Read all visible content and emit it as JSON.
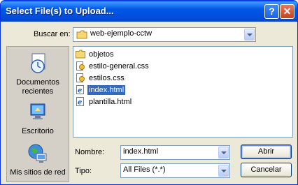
{
  "dialog": {
    "title": "Select File(s) to Upload...",
    "help_symbol": "?",
    "close_symbol": "✕"
  },
  "lookin": {
    "label": "Buscar en:",
    "value": "web-ejemplo-cctw"
  },
  "places": [
    {
      "label": "Documentos recientes",
      "icon": "recent-documents-icon"
    },
    {
      "label": "Escritorio",
      "icon": "desktop-icon"
    },
    {
      "label": "Mis sitios de red",
      "icon": "network-places-icon"
    }
  ],
  "files": [
    {
      "name": "objetos",
      "type": "folder-icon",
      "selected": false
    },
    {
      "name": "estilo-general.css",
      "type": "css-file-icon",
      "selected": false
    },
    {
      "name": "estilos.css",
      "type": "css-file-icon",
      "selected": false
    },
    {
      "name": "index.html",
      "type": "html-file-icon",
      "selected": true
    },
    {
      "name": "plantilla.html",
      "type": "html-file-icon",
      "selected": false
    }
  ],
  "filename": {
    "label": "Nombre:",
    "value": "index.html"
  },
  "filetype": {
    "label": "Tipo:",
    "value": "All Files (*.*)"
  },
  "buttons": {
    "open": "Abrir",
    "cancel": "Cancelar"
  },
  "colors": {
    "title_bar": "#0054e3",
    "dialog_bg": "#ece9d8",
    "selection": "#316ac5",
    "close_button": "#d9552d"
  }
}
